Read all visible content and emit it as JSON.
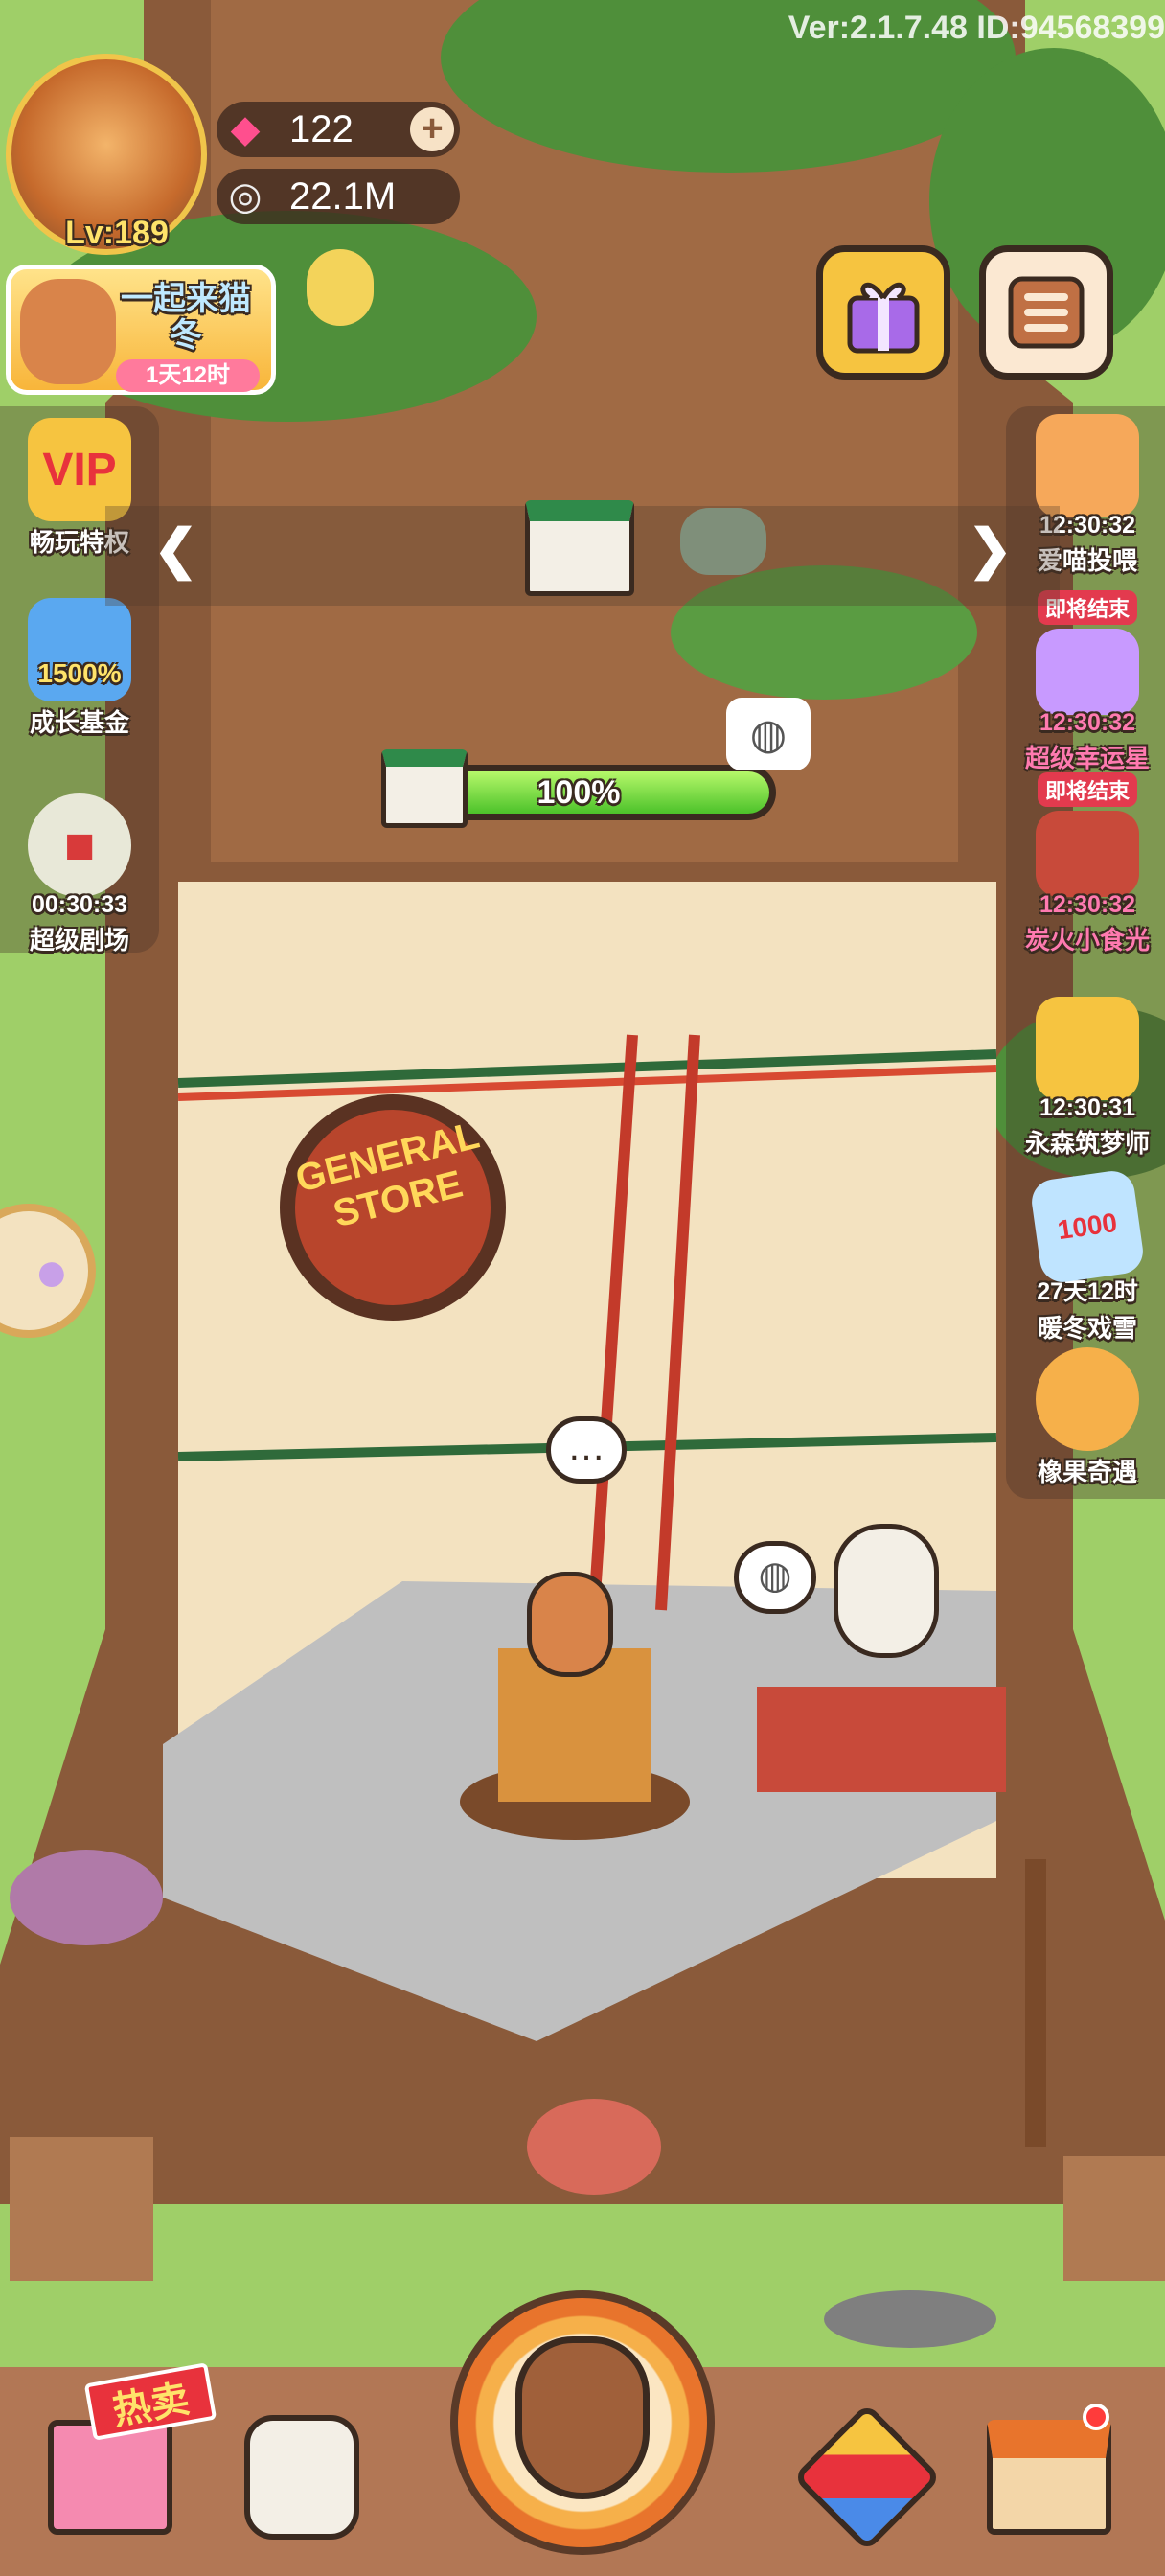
{
  "version_text": "Ver:2.1.7.48 ID:94568399",
  "player": {
    "level": "Lv:189"
  },
  "resources": {
    "gems": "122",
    "seeds": "22.1M"
  },
  "event": {
    "title": "一起来猫冬",
    "timer": "1天12时"
  },
  "store_sign": {
    "line1": "GENERAL",
    "line2": "STORE"
  },
  "floor_progress": {
    "percent": 100,
    "label": "100%"
  },
  "left_side": [
    {
      "label": "畅玩特权",
      "icon": "vip-icon"
    },
    {
      "label": "成长基金",
      "badge": "1500%",
      "icon": "growth-fund-icon"
    },
    {
      "time": "00:30:33",
      "label": "超级剧场",
      "icon": "theater-icon"
    }
  ],
  "right_side": [
    {
      "time": "12:30:32",
      "label": "爱喵投喂",
      "icon": "cat-feed-icon"
    },
    {
      "ending": "即将结束",
      "time": "12:30:32",
      "label": "超级幸运星",
      "icon": "lucky-star-icon"
    },
    {
      "ending": "即将结束",
      "time": "12:30:32",
      "label": "炭火小食光",
      "icon": "grill-icon"
    },
    {
      "time": "12:30:31",
      "label": "永森筑梦师",
      "icon": "trophy-icon"
    },
    {
      "badge": "1000",
      "time": "27天12时",
      "label": "暖冬戏雪",
      "icon": "snow-ticket-icon"
    },
    {
      "label": "橡果奇遇",
      "icon": "acorn-adventure-icon"
    }
  ],
  "bottom": {
    "hot_label": "热卖"
  },
  "colors": {
    "grass": "#8fbf5a",
    "bark": "#8a5a3a",
    "progress": "#4cc22a",
    "accent": "#f6c440"
  }
}
